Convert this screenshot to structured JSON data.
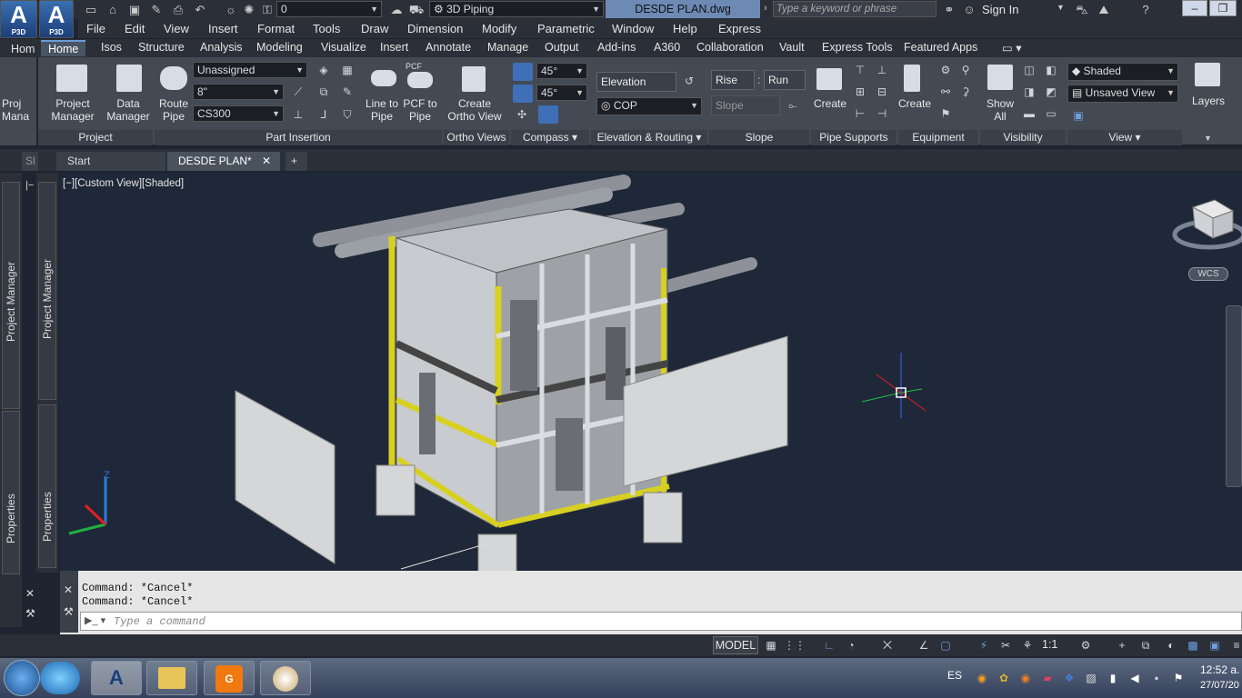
{
  "title_bar": {
    "app_logo": "A",
    "app_logo_sub": "P3D",
    "layer_value": "0",
    "workspace": "3D Piping",
    "document": "DESDE PLAN.dwg",
    "search_placeholder": "Type a keyword or phrase",
    "sign_in": "Sign In"
  },
  "menu": [
    "File",
    "Edit",
    "View",
    "Insert",
    "Format",
    "Tools",
    "Draw",
    "Dimension",
    "Modify",
    "Parametric",
    "Window",
    "Help",
    "Express"
  ],
  "left_tab": "Hom",
  "ribbon_tabs": [
    "Home",
    "Isos",
    "Structure",
    "Analysis",
    "Modeling",
    "Visualize",
    "Insert",
    "Annotate",
    "Manage",
    "Output",
    "Add-ins",
    "A360",
    "Collaboration",
    "Vault",
    "Express Tools",
    "Featured Apps"
  ],
  "ribbon": {
    "project_manager": "Project Manager",
    "data_manager": "Data Manager",
    "proj_clip": "Proj Mana",
    "route_pipe": "Route Pipe",
    "spec_unassigned": "Unassigned",
    "size": "8\"",
    "spec": "CS300",
    "line_to_pipe": "Line to Pipe",
    "pcf_to_pipe": "PCF to Pipe",
    "pcf_icon": "PCF",
    "create_ortho": "Create Ortho View",
    "angle1": "45°",
    "angle2": "45°",
    "elevation": "Elevation",
    "cop": "COP",
    "rise": "Rise",
    "run": "Run",
    "slope": "Slope",
    "support_create": "Create",
    "equip_create": "Create",
    "show_all": "Show All",
    "visual_style": "Shaded",
    "view_name": "Unsaved View",
    "layers": "Layers"
  },
  "panels": [
    "Project",
    "Part Insertion",
    "Ortho Views",
    "Compass",
    "Elevation & Routing",
    "Slope",
    "Pipe Supports",
    "Equipment",
    "Visibility",
    "View"
  ],
  "doc_tabs": {
    "start": "Start",
    "current": "DESDE PLAN*"
  },
  "viewport_label": "[−][Custom View][Shaded]",
  "wcs": "WCS",
  "side_panels": {
    "project_manager": "Project Manager",
    "properties": "Properties",
    "clip": "Sl"
  },
  "command_history": [
    "Command: *Cancel*",
    "Command: *Cancel*"
  ],
  "command_placeholder": "Type a command",
  "status": {
    "model": "MODEL",
    "scale": "1:1"
  },
  "taskbar": {
    "lang": "ES",
    "time": "12:52 a.",
    "date": "27/07/20"
  },
  "colors": {
    "ribbon": "#434a54",
    "titlebar": "#2b2f37",
    "viewport": "#1f2838",
    "accent": "#6a9bd6",
    "yellow": "#d8d020"
  }
}
